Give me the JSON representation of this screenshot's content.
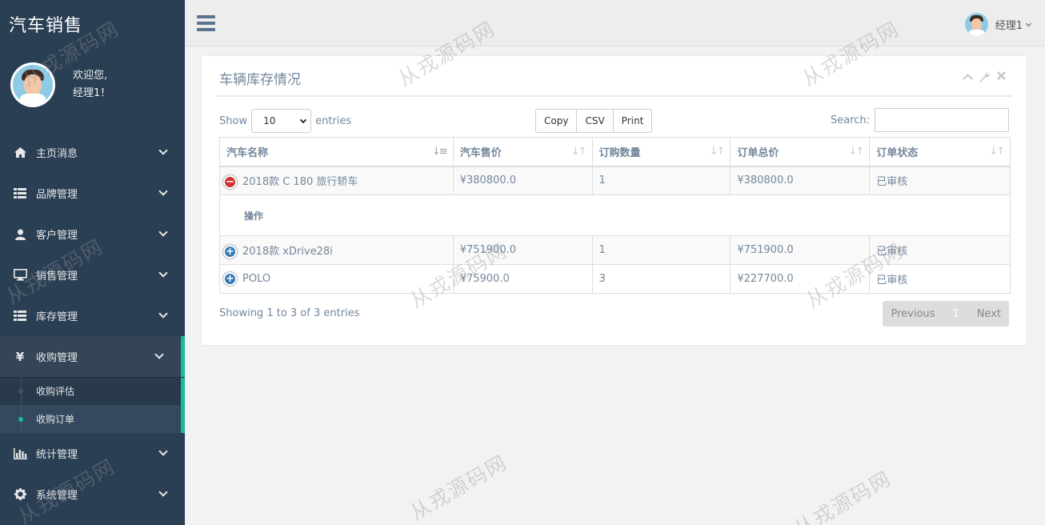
{
  "sidebar": {
    "brand": "汽车销售",
    "welcome": "欢迎您,",
    "username": "经理1！",
    "menu": [
      {
        "label": "主页消息",
        "icon": "home-icon"
      },
      {
        "label": "品牌管理",
        "icon": "list-icon"
      },
      {
        "label": "客户管理",
        "icon": "user-icon"
      },
      {
        "label": "销售管理",
        "icon": "monitor-icon"
      },
      {
        "label": "库存管理",
        "icon": "list-icon"
      },
      {
        "label": "收购管理",
        "icon": "yen-icon"
      },
      {
        "label": "统计管理",
        "icon": "bar-chart-icon"
      },
      {
        "label": "系统管理",
        "icon": "gear-icon"
      }
    ],
    "submenu": [
      {
        "label": "收购评估"
      },
      {
        "label": "收购订单"
      }
    ],
    "active_color": "#1ABB9C"
  },
  "topbar": {
    "user": "经理1"
  },
  "panel": {
    "title": "车辆库存情况",
    "show_label": "Show",
    "entries_label": "entries",
    "page_length": "10",
    "buttons": [
      "Copy",
      "CSV",
      "Print"
    ],
    "search_label": "Search:",
    "columns": [
      "汽车名称",
      "汽车售价",
      "订购数量",
      "订单总价",
      "订单状态"
    ],
    "rows": [
      {
        "name": "2018款 C 180 旅行轿车",
        "price": "¥380800.0",
        "qty": "1",
        "total": "¥380800.0",
        "status": "已审核",
        "expanded": true
      },
      {
        "name": "2018款 xDrive28i",
        "price": "¥751900.0",
        "qty": "1",
        "total": "¥751900.0",
        "status": "已审核",
        "expanded": false
      },
      {
        "name": "POLO",
        "price": "¥75900.0",
        "qty": "3",
        "total": "¥227700.0",
        "status": "已审核",
        "expanded": false
      }
    ],
    "child_label": "操作",
    "info": "Showing 1 to 3 of 3 entries",
    "pager": {
      "prev": "Previous",
      "page": "1",
      "next": "Next"
    }
  },
  "watermark": "从戎源码网"
}
